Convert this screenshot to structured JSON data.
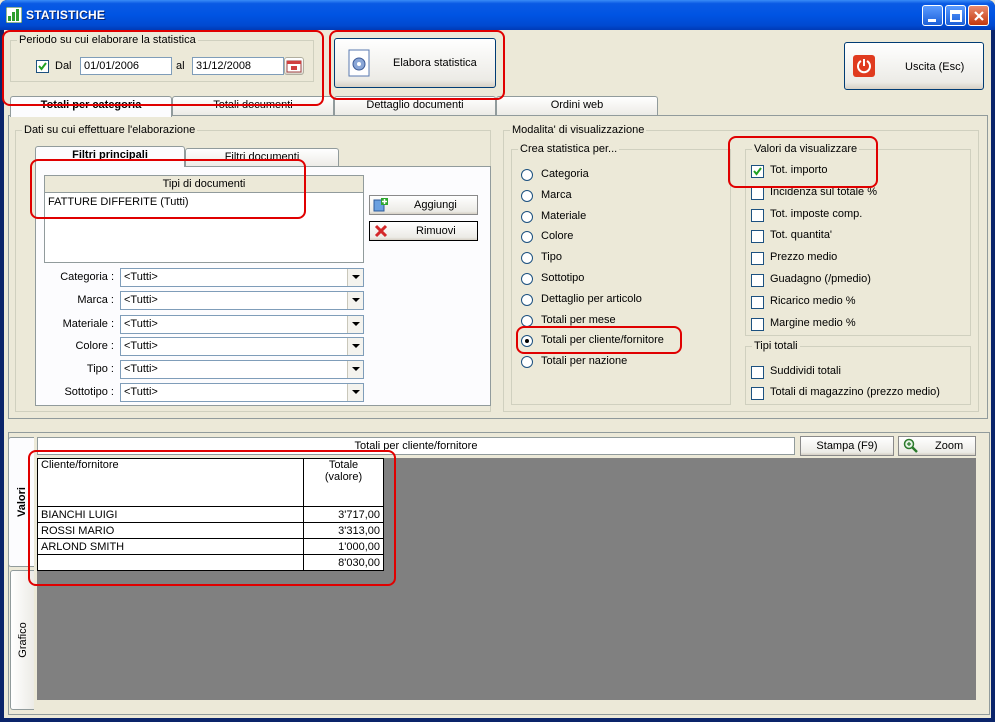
{
  "window": {
    "title": "STATISTICHE"
  },
  "period": {
    "legend": "Periodo su cui elaborare la statistica",
    "enabled": true,
    "from_label": "Dal",
    "from_value": "01/01/2006",
    "to_label": "al",
    "to_value": "31/12/2008"
  },
  "toolbar": {
    "elabora_label": "Elabora statistica",
    "exit_label": "Uscita (Esc)"
  },
  "main_tabs": [
    {
      "label": "Totali per categoria",
      "active": true
    },
    {
      "label": "Totali documenti"
    },
    {
      "label": "Dettaglio documenti"
    },
    {
      "label": "Ordini web"
    }
  ],
  "data_group": {
    "legend": "Dati su cui effettuare l'elaborazione",
    "tabs": [
      {
        "label": "Filtri principali",
        "active": true
      },
      {
        "label": "Filtri documenti"
      }
    ],
    "doc_types": {
      "header": "Tipi di documenti",
      "items": [
        "FATTURE DIFFERITE (Tutti)"
      ]
    },
    "add_label": "Aggiungi",
    "remove_label": "Rimuovi",
    "filters": [
      {
        "label": "Categoria :",
        "value": "<Tutti>"
      },
      {
        "label": "Marca :",
        "value": "<Tutti>"
      },
      {
        "label": "Materiale :",
        "value": "<Tutti>"
      },
      {
        "label": "Colore :",
        "value": "<Tutti>"
      },
      {
        "label": "Tipo :",
        "value": "<Tutti>"
      },
      {
        "label": "Sottotipo :",
        "value": "<Tutti>"
      }
    ]
  },
  "display_mode": {
    "legend": "Modalita' di visualizzazione",
    "create_for": {
      "legend": "Crea statistica per...",
      "options": [
        "Categoria",
        "Marca",
        "Materiale",
        "Colore",
        "Tipo",
        "Sottotipo",
        "Dettaglio per articolo",
        "Totali per mese",
        "Totali per cliente/fornitore",
        "Totali per nazione"
      ],
      "selected_index": 8
    },
    "values": {
      "legend": "Valori da visualizzare",
      "options": [
        {
          "label": "Tot. importo",
          "checked": true
        },
        {
          "label": "Incidenza sul totale %",
          "checked": false
        },
        {
          "label": "Tot. imposte comp.",
          "checked": false
        },
        {
          "label": "Tot. quantita'",
          "checked": false
        },
        {
          "label": "Prezzo medio",
          "checked": false
        },
        {
          "label": "Guadagno (/pmedio)",
          "checked": false
        },
        {
          "label": "Ricarico medio %",
          "checked": false
        },
        {
          "label": "Margine medio %",
          "checked": false
        }
      ]
    },
    "totals": {
      "legend": "Tipi totali",
      "options": [
        {
          "label": "Suddividi totali",
          "checked": false
        },
        {
          "label": "Totali di magazzino (prezzo medio)",
          "checked": false
        }
      ]
    }
  },
  "results": {
    "side_tabs": [
      {
        "label": "Valori",
        "active": true
      },
      {
        "label": "Grafico"
      }
    ],
    "caption": "Totali per cliente/fornitore",
    "print_label": "Stampa (F9)",
    "zoom_label": "Zoom",
    "table": {
      "col1": "Cliente/fornitore",
      "col2_line1": "Totale",
      "col2_line2": "(valore)",
      "rows": [
        {
          "name": "BIANCHI LUIGI",
          "value": "3'717,00"
        },
        {
          "name": "ROSSI MARIO",
          "value": "3'313,00"
        },
        {
          "name": "ARLOND SMITH",
          "value": "1'000,00"
        },
        {
          "name": "",
          "value": "8'030,00"
        }
      ]
    }
  },
  "colors": {
    "title_bar": "#0054e3",
    "highlight": "#e00000",
    "grid_background": "#808080"
  }
}
